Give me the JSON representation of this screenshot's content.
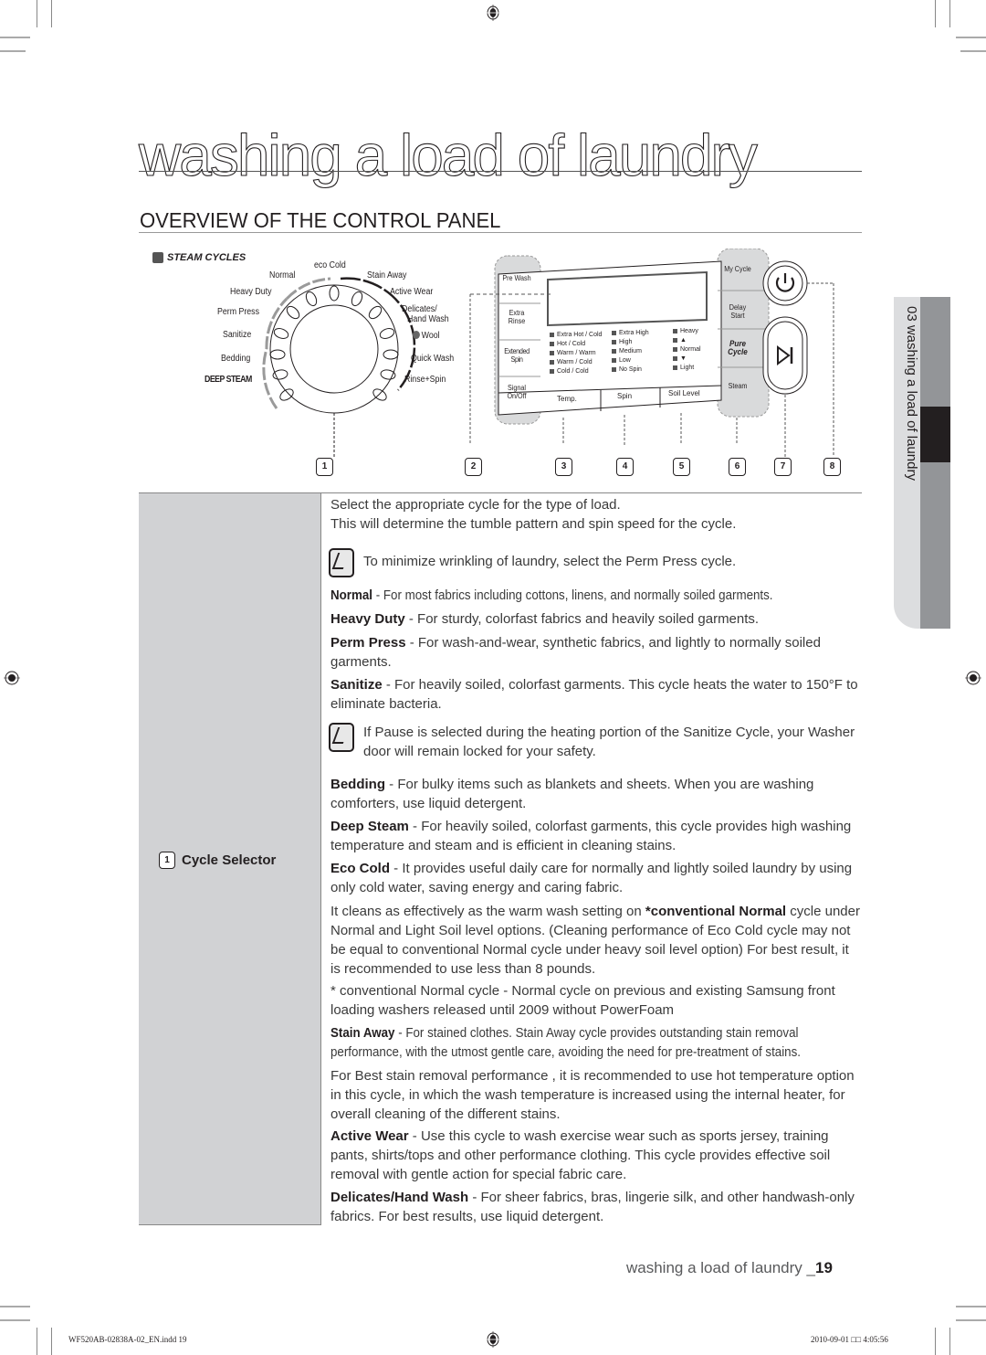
{
  "page": {
    "title": "washing a load of laundry",
    "section_title": "OVERVIEW OF THE CONTROL PANEL",
    "side_tab": "03 washing a load of laundry",
    "footer_text": "washing a load of laundry _",
    "footer_page": "19",
    "slug_left": "WF520AB-02838A-02_EN.indd   19",
    "slug_right": "2010-09-01   □□ 4:05:56"
  },
  "diagram": {
    "steam_header": "STEAM CYCLES",
    "dial_labels_left": [
      "Normal",
      "Heavy Duty",
      "Perm Press",
      "Sanitize",
      "Bedding",
      "DEEP STEAM"
    ],
    "dial_label_top": "eco Cold",
    "dial_labels_right": [
      "Stain Away",
      "Active Wear",
      "Delicates/",
      "Hand Wash",
      "Wool",
      "Quick Wash",
      "Rinse+Spin"
    ],
    "left_buttons": [
      "Pre Wash",
      "Extra Rinse",
      "Extended Spin",
      "Signal On/Off"
    ],
    "right_buttons": [
      "My Cycle",
      "Delay Start",
      "Pure Cycle",
      "Steam"
    ],
    "temp_options": [
      "Extra Hot / Cold",
      "Hot / Cold",
      "Warm / Warm",
      "Warm / Cold",
      "Cold / Cold"
    ],
    "spin_options": [
      "Extra High",
      "High",
      "Medium",
      "Low",
      "No Spin"
    ],
    "soil_options": [
      "Heavy",
      "▲",
      "Normal",
      "▼",
      "Light"
    ],
    "bottom_buttons": [
      "Temp.",
      "Spin",
      "Soil Level"
    ],
    "callouts": [
      "1",
      "2",
      "3",
      "4",
      "5",
      "6",
      "7",
      "8"
    ]
  },
  "content": {
    "left_label_number": "1",
    "left_label": "Cycle Selector",
    "intro_1": "Select the appropriate cycle for the type of load.",
    "intro_2": "This will determine the tumble pattern and spin speed for the cycle.",
    "note_1": "To minimize wrinkling of laundry, select the Perm Press cycle.",
    "normal_term": "Normal",
    "normal_desc": " - For most fabrics including cottons, linens, and normally soiled garments.",
    "heavy_term": "Heavy Duty",
    "heavy_desc": " - For sturdy, colorfast fabrics and heavily soiled garments.",
    "perm_term": "Perm Press",
    "perm_desc": " - For wash-and-wear, synthetic fabrics, and lightly to normally soiled garments.",
    "sanitize_term": "Sanitize",
    "sanitize_desc": " - For heavily soiled, colorfast garments. This cycle heats the water to 150°F to eliminate bacteria.",
    "note_2": "If Pause is selected during the heating portion of the Sanitize Cycle, your Washer door will remain locked for your safety.",
    "bedding_term": "Bedding",
    "bedding_desc": " - For bulky items such as blankets and sheets. When you are washing comforters, use liquid detergent.",
    "deep_term": "Deep Steam",
    "deep_desc": " - For heavily soiled, colorfast garments, this cycle provides high washing temperature and steam and is efficient in cleaning stains.",
    "eco_term": "Eco Cold",
    "eco_desc": " -  It provides useful daily care for normally and lightly soiled laundry by using only cold water, saving energy and caring fabric.",
    "eco_more_1": "It cleans as effectively as the warm wash setting on ",
    "eco_more_bold": "*conventional Normal",
    "eco_more_2": " cycle under Normal and Light Soil level options. (Cleaning performance of Eco Cold cycle may not be equal to conventional Normal cycle under heavy soil level option) For best result, it is recommended to use less than 8 pounds.",
    "footnote": "* conventional Normal cycle - Normal cycle on previous and existing Samsung front loading washers released until 2009 without PowerFoam",
    "stain_term": "Stain Away",
    "stain_desc": " - For stained clothes. Stain Away cycle provides outstanding stain removal performance, with the utmost gentle care, avoiding the need for pre-treatment of stains.",
    "stain_more": "For Best stain removal performance , it is recommended to use hot temperature option in this cycle, in which the wash temperature is increased using the internal heater, for overall cleaning of the different stains.",
    "active_term": "Active Wear",
    "active_desc": " - Use this cycle to wash exercise wear such as sports jersey, training pants, shirts/tops  and other performance clothing. This cycle provides effective soil removal with gentle action for special fabric care.",
    "delicates_term": "Delicates/Hand Wash",
    "delicates_desc": " - For sheer fabrics, bras, lingerie silk, and other handwash-only fabrics. For best results, use liquid detergent."
  }
}
